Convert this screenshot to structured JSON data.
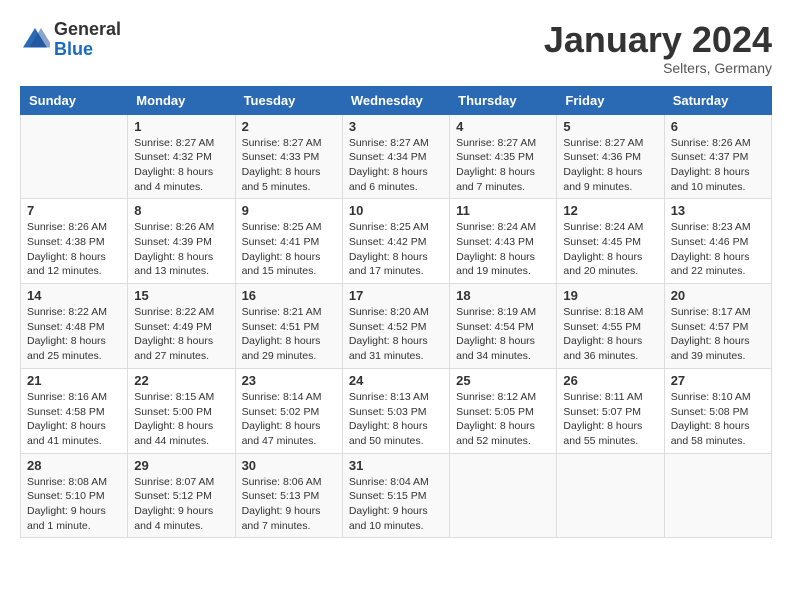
{
  "header": {
    "logo_general": "General",
    "logo_blue": "Blue",
    "month": "January 2024",
    "location": "Selters, Germany"
  },
  "weekdays": [
    "Sunday",
    "Monday",
    "Tuesday",
    "Wednesday",
    "Thursday",
    "Friday",
    "Saturday"
  ],
  "rows": [
    [
      {
        "day": "",
        "sunrise": "",
        "sunset": "",
        "daylight": ""
      },
      {
        "day": "1",
        "sunrise": "8:27 AM",
        "sunset": "4:32 PM",
        "daylight": "8 hours and 4 minutes."
      },
      {
        "day": "2",
        "sunrise": "8:27 AM",
        "sunset": "4:33 PM",
        "daylight": "8 hours and 5 minutes."
      },
      {
        "day": "3",
        "sunrise": "8:27 AM",
        "sunset": "4:34 PM",
        "daylight": "8 hours and 6 minutes."
      },
      {
        "day": "4",
        "sunrise": "8:27 AM",
        "sunset": "4:35 PM",
        "daylight": "8 hours and 7 minutes."
      },
      {
        "day": "5",
        "sunrise": "8:27 AM",
        "sunset": "4:36 PM",
        "daylight": "8 hours and 9 minutes."
      },
      {
        "day": "6",
        "sunrise": "8:26 AM",
        "sunset": "4:37 PM",
        "daylight": "8 hours and 10 minutes."
      }
    ],
    [
      {
        "day": "7",
        "sunrise": "8:26 AM",
        "sunset": "4:38 PM",
        "daylight": "8 hours and 12 minutes."
      },
      {
        "day": "8",
        "sunrise": "8:26 AM",
        "sunset": "4:39 PM",
        "daylight": "8 hours and 13 minutes."
      },
      {
        "day": "9",
        "sunrise": "8:25 AM",
        "sunset": "4:41 PM",
        "daylight": "8 hours and 15 minutes."
      },
      {
        "day": "10",
        "sunrise": "8:25 AM",
        "sunset": "4:42 PM",
        "daylight": "8 hours and 17 minutes."
      },
      {
        "day": "11",
        "sunrise": "8:24 AM",
        "sunset": "4:43 PM",
        "daylight": "8 hours and 19 minutes."
      },
      {
        "day": "12",
        "sunrise": "8:24 AM",
        "sunset": "4:45 PM",
        "daylight": "8 hours and 20 minutes."
      },
      {
        "day": "13",
        "sunrise": "8:23 AM",
        "sunset": "4:46 PM",
        "daylight": "8 hours and 22 minutes."
      }
    ],
    [
      {
        "day": "14",
        "sunrise": "8:22 AM",
        "sunset": "4:48 PM",
        "daylight": "8 hours and 25 minutes."
      },
      {
        "day": "15",
        "sunrise": "8:22 AM",
        "sunset": "4:49 PM",
        "daylight": "8 hours and 27 minutes."
      },
      {
        "day": "16",
        "sunrise": "8:21 AM",
        "sunset": "4:51 PM",
        "daylight": "8 hours and 29 minutes."
      },
      {
        "day": "17",
        "sunrise": "8:20 AM",
        "sunset": "4:52 PM",
        "daylight": "8 hours and 31 minutes."
      },
      {
        "day": "18",
        "sunrise": "8:19 AM",
        "sunset": "4:54 PM",
        "daylight": "8 hours and 34 minutes."
      },
      {
        "day": "19",
        "sunrise": "8:18 AM",
        "sunset": "4:55 PM",
        "daylight": "8 hours and 36 minutes."
      },
      {
        "day": "20",
        "sunrise": "8:17 AM",
        "sunset": "4:57 PM",
        "daylight": "8 hours and 39 minutes."
      }
    ],
    [
      {
        "day": "21",
        "sunrise": "8:16 AM",
        "sunset": "4:58 PM",
        "daylight": "8 hours and 41 minutes."
      },
      {
        "day": "22",
        "sunrise": "8:15 AM",
        "sunset": "5:00 PM",
        "daylight": "8 hours and 44 minutes."
      },
      {
        "day": "23",
        "sunrise": "8:14 AM",
        "sunset": "5:02 PM",
        "daylight": "8 hours and 47 minutes."
      },
      {
        "day": "24",
        "sunrise": "8:13 AM",
        "sunset": "5:03 PM",
        "daylight": "8 hours and 50 minutes."
      },
      {
        "day": "25",
        "sunrise": "8:12 AM",
        "sunset": "5:05 PM",
        "daylight": "8 hours and 52 minutes."
      },
      {
        "day": "26",
        "sunrise": "8:11 AM",
        "sunset": "5:07 PM",
        "daylight": "8 hours and 55 minutes."
      },
      {
        "day": "27",
        "sunrise": "8:10 AM",
        "sunset": "5:08 PM",
        "daylight": "8 hours and 58 minutes."
      }
    ],
    [
      {
        "day": "28",
        "sunrise": "8:08 AM",
        "sunset": "5:10 PM",
        "daylight": "9 hours and 1 minute."
      },
      {
        "day": "29",
        "sunrise": "8:07 AM",
        "sunset": "5:12 PM",
        "daylight": "9 hours and 4 minutes."
      },
      {
        "day": "30",
        "sunrise": "8:06 AM",
        "sunset": "5:13 PM",
        "daylight": "9 hours and 7 minutes."
      },
      {
        "day": "31",
        "sunrise": "8:04 AM",
        "sunset": "5:15 PM",
        "daylight": "9 hours and 10 minutes."
      },
      {
        "day": "",
        "sunrise": "",
        "sunset": "",
        "daylight": ""
      },
      {
        "day": "",
        "sunrise": "",
        "sunset": "",
        "daylight": ""
      },
      {
        "day": "",
        "sunrise": "",
        "sunset": "",
        "daylight": ""
      }
    ]
  ]
}
